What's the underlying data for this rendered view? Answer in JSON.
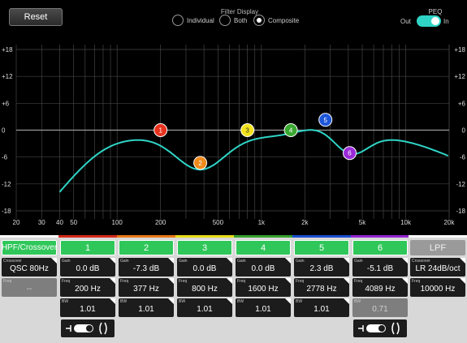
{
  "toolbar": {
    "reset_label": "Reset"
  },
  "filter_display": {
    "title": "Filter Display",
    "options": [
      {
        "label": "Individual",
        "selected": false
      },
      {
        "label": "Both",
        "selected": false
      },
      {
        "label": "Composite",
        "selected": true
      }
    ]
  },
  "peq": {
    "title": "PEQ",
    "off_label": "Out",
    "on_label": "In",
    "enabled": true
  },
  "graph": {
    "y_ticks": [
      "+18",
      "+12",
      "+6",
      "0",
      "-6",
      "-12",
      "-18"
    ],
    "x_ticks": [
      "20",
      "30",
      "40",
      "50",
      "100",
      "200",
      "500",
      "1k",
      "2k",
      "5k",
      "10k",
      "20k"
    ],
    "nodes": [
      {
        "label": "1",
        "freq_hz": 200,
        "gain_db": 0.0,
        "color": "#e8321e"
      },
      {
        "label": "2",
        "freq_hz": 377,
        "gain_db": -7.3,
        "color": "#f08a1c"
      },
      {
        "label": "3",
        "freq_hz": 800,
        "gain_db": 0.0,
        "color": "#f2e21c"
      },
      {
        "label": "4",
        "freq_hz": 1600,
        "gain_db": 0.0,
        "color": "#3aa832"
      },
      {
        "label": "5",
        "freq_hz": 2778,
        "gain_db": 2.3,
        "color": "#1e56d8"
      },
      {
        "label": "6",
        "freq_hz": 4089,
        "gain_db": -5.1,
        "color": "#9a2ad8"
      }
    ],
    "curve_color": "#2fd4c6"
  },
  "columns": {
    "hpf": {
      "header": "HPF/Crossover",
      "crossover_label": "Crossover",
      "crossover_value": "QSC 80Hz",
      "freq_label": "Freq",
      "freq_value": "--"
    },
    "bands": [
      {
        "header": "1",
        "color": "#d42a1a",
        "gain_label": "Gain",
        "gain": "0.0 dB",
        "freq_label": "Freq",
        "freq": "200 Hz",
        "bw_label": "BW",
        "bw": "1.01",
        "bw_enabled": true,
        "shelf": true
      },
      {
        "header": "2",
        "color": "#e87a18",
        "gain_label": "Gain",
        "gain": "-7.3 dB",
        "freq_label": "Freq",
        "freq": "377 Hz",
        "bw_label": "BW",
        "bw": "1.01",
        "bw_enabled": true,
        "shelf": false
      },
      {
        "header": "3",
        "color": "#e8dc18",
        "gain_label": "Gain",
        "gain": "0.0 dB",
        "freq_label": "Freq",
        "freq": "800 Hz",
        "bw_label": "BW",
        "bw": "1.01",
        "bw_enabled": true,
        "shelf": false
      },
      {
        "header": "4",
        "color": "#36a02e",
        "gain_label": "Gain",
        "gain": "0.0 dB",
        "freq_label": "Freq",
        "freq": "1600 Hz",
        "bw_label": "BW",
        "bw": "1.01",
        "bw_enabled": true,
        "shelf": false
      },
      {
        "header": "5",
        "color": "#1a4ed0",
        "gain_label": "Gain",
        "gain": "2.3 dB",
        "freq_label": "Freq",
        "freq": "2778 Hz",
        "bw_label": "BW",
        "bw": "1.01",
        "bw_enabled": true,
        "shelf": false
      },
      {
        "header": "6",
        "color": "#9226d0",
        "gain_label": "Gain",
        "gain": "-5.1 dB",
        "freq_label": "Freq",
        "freq": "4089 Hz",
        "bw_label": "BW",
        "bw": "0.71",
        "bw_enabled": false,
        "shelf": true
      }
    ],
    "lpf": {
      "header": "LPF",
      "crossover_label": "Crossover",
      "crossover_value": "LR 24dB/oct",
      "freq_label": "Freq",
      "freq_value": "10000 Hz"
    }
  }
}
